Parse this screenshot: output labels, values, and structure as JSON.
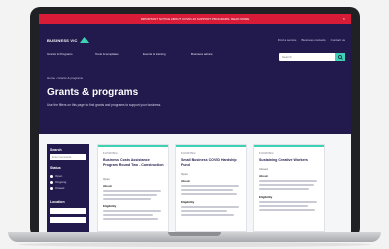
{
  "alert": {
    "text": "IMPORTANT NOTICE ABOUT COVID-19 SUPPORT PROGRAMS. READ MORE",
    "close": "×"
  },
  "header": {
    "logo_text": "BUSINESS VIC",
    "utils": [
      "Find a service",
      "Business contacts",
      "Contact us"
    ],
    "nav": [
      "Grants & Programs",
      "Tools & templates",
      "Events & training",
      "Business advice"
    ],
    "search_placeholder": "Search"
  },
  "breadcrumb": "Home  ›  Grants & programs",
  "hero": {
    "title": "Grants & programs",
    "intro": "Use the filters on this page to find grants and programs to support your business."
  },
  "sidebar": {
    "search_label": "Search",
    "search_placeholder": "Enter keywords",
    "status_label": "Status",
    "status_options": [
      "Open",
      "Ongoing",
      "Closed"
    ],
    "location_label": "Location"
  },
  "cards": [
    {
      "tag": "FUNDING",
      "title": "Business Costs Assistance Program Round Two - Construction",
      "meta": "Open",
      "section1": "About",
      "section2": "Eligibility"
    },
    {
      "tag": "FUNDING",
      "title": "Small Business COVID Hardship Fund",
      "meta": "Open",
      "section1": "About",
      "section2": "Eligibility"
    },
    {
      "tag": "FUNDING",
      "title": "Sustaining Creative Workers",
      "meta": "Closed",
      "section1": "About",
      "section2": "Eligibility"
    }
  ],
  "colors": {
    "brand": "#221a4d",
    "accent": "#3ed2b4",
    "alert": "#d81b37"
  }
}
